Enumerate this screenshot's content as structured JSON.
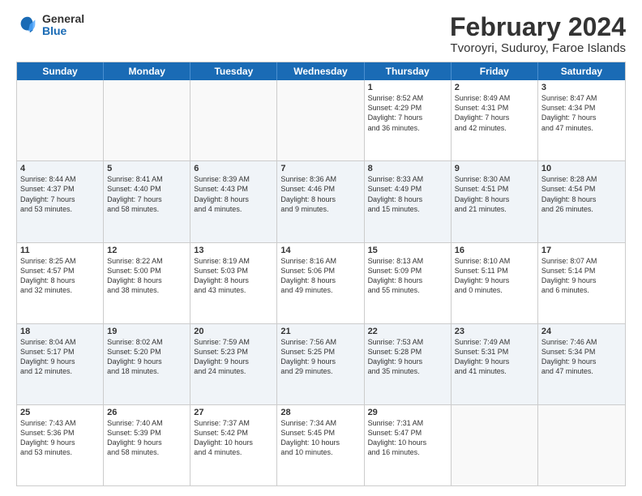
{
  "logo": {
    "general": "General",
    "blue": "Blue"
  },
  "title": "February 2024",
  "location": "Tvoroyri, Suduroy, Faroe Islands",
  "days": [
    "Sunday",
    "Monday",
    "Tuesday",
    "Wednesday",
    "Thursday",
    "Friday",
    "Saturday"
  ],
  "weeks": [
    [
      {
        "day": "",
        "text": "",
        "empty": true
      },
      {
        "day": "",
        "text": "",
        "empty": true
      },
      {
        "day": "",
        "text": "",
        "empty": true
      },
      {
        "day": "",
        "text": "",
        "empty": true
      },
      {
        "day": "1",
        "text": "Sunrise: 8:52 AM\nSunset: 4:29 PM\nDaylight: 7 hours\nand 36 minutes."
      },
      {
        "day": "2",
        "text": "Sunrise: 8:49 AM\nSunset: 4:31 PM\nDaylight: 7 hours\nand 42 minutes."
      },
      {
        "day": "3",
        "text": "Sunrise: 8:47 AM\nSunset: 4:34 PM\nDaylight: 7 hours\nand 47 minutes."
      }
    ],
    [
      {
        "day": "4",
        "text": "Sunrise: 8:44 AM\nSunset: 4:37 PM\nDaylight: 7 hours\nand 53 minutes.",
        "shade": true
      },
      {
        "day": "5",
        "text": "Sunrise: 8:41 AM\nSunset: 4:40 PM\nDaylight: 7 hours\nand 58 minutes.",
        "shade": true
      },
      {
        "day": "6",
        "text": "Sunrise: 8:39 AM\nSunset: 4:43 PM\nDaylight: 8 hours\nand 4 minutes.",
        "shade": true
      },
      {
        "day": "7",
        "text": "Sunrise: 8:36 AM\nSunset: 4:46 PM\nDaylight: 8 hours\nand 9 minutes.",
        "shade": true
      },
      {
        "day": "8",
        "text": "Sunrise: 8:33 AM\nSunset: 4:49 PM\nDaylight: 8 hours\nand 15 minutes.",
        "shade": true
      },
      {
        "day": "9",
        "text": "Sunrise: 8:30 AM\nSunset: 4:51 PM\nDaylight: 8 hours\nand 21 minutes.",
        "shade": true
      },
      {
        "day": "10",
        "text": "Sunrise: 8:28 AM\nSunset: 4:54 PM\nDaylight: 8 hours\nand 26 minutes.",
        "shade": true
      }
    ],
    [
      {
        "day": "11",
        "text": "Sunrise: 8:25 AM\nSunset: 4:57 PM\nDaylight: 8 hours\nand 32 minutes."
      },
      {
        "day": "12",
        "text": "Sunrise: 8:22 AM\nSunset: 5:00 PM\nDaylight: 8 hours\nand 38 minutes."
      },
      {
        "day": "13",
        "text": "Sunrise: 8:19 AM\nSunset: 5:03 PM\nDaylight: 8 hours\nand 43 minutes."
      },
      {
        "day": "14",
        "text": "Sunrise: 8:16 AM\nSunset: 5:06 PM\nDaylight: 8 hours\nand 49 minutes."
      },
      {
        "day": "15",
        "text": "Sunrise: 8:13 AM\nSunset: 5:09 PM\nDaylight: 8 hours\nand 55 minutes."
      },
      {
        "day": "16",
        "text": "Sunrise: 8:10 AM\nSunset: 5:11 PM\nDaylight: 9 hours\nand 0 minutes."
      },
      {
        "day": "17",
        "text": "Sunrise: 8:07 AM\nSunset: 5:14 PM\nDaylight: 9 hours\nand 6 minutes."
      }
    ],
    [
      {
        "day": "18",
        "text": "Sunrise: 8:04 AM\nSunset: 5:17 PM\nDaylight: 9 hours\nand 12 minutes.",
        "shade": true
      },
      {
        "day": "19",
        "text": "Sunrise: 8:02 AM\nSunset: 5:20 PM\nDaylight: 9 hours\nand 18 minutes.",
        "shade": true
      },
      {
        "day": "20",
        "text": "Sunrise: 7:59 AM\nSunset: 5:23 PM\nDaylight: 9 hours\nand 24 minutes.",
        "shade": true
      },
      {
        "day": "21",
        "text": "Sunrise: 7:56 AM\nSunset: 5:25 PM\nDaylight: 9 hours\nand 29 minutes.",
        "shade": true
      },
      {
        "day": "22",
        "text": "Sunrise: 7:53 AM\nSunset: 5:28 PM\nDaylight: 9 hours\nand 35 minutes.",
        "shade": true
      },
      {
        "day": "23",
        "text": "Sunrise: 7:49 AM\nSunset: 5:31 PM\nDaylight: 9 hours\nand 41 minutes.",
        "shade": true
      },
      {
        "day": "24",
        "text": "Sunrise: 7:46 AM\nSunset: 5:34 PM\nDaylight: 9 hours\nand 47 minutes.",
        "shade": true
      }
    ],
    [
      {
        "day": "25",
        "text": "Sunrise: 7:43 AM\nSunset: 5:36 PM\nDaylight: 9 hours\nand 53 minutes."
      },
      {
        "day": "26",
        "text": "Sunrise: 7:40 AM\nSunset: 5:39 PM\nDaylight: 9 hours\nand 58 minutes."
      },
      {
        "day": "27",
        "text": "Sunrise: 7:37 AM\nSunset: 5:42 PM\nDaylight: 10 hours\nand 4 minutes."
      },
      {
        "day": "28",
        "text": "Sunrise: 7:34 AM\nSunset: 5:45 PM\nDaylight: 10 hours\nand 10 minutes."
      },
      {
        "day": "29",
        "text": "Sunrise: 7:31 AM\nSunset: 5:47 PM\nDaylight: 10 hours\nand 16 minutes."
      },
      {
        "day": "",
        "text": "",
        "empty": true
      },
      {
        "day": "",
        "text": "",
        "empty": true
      }
    ]
  ]
}
